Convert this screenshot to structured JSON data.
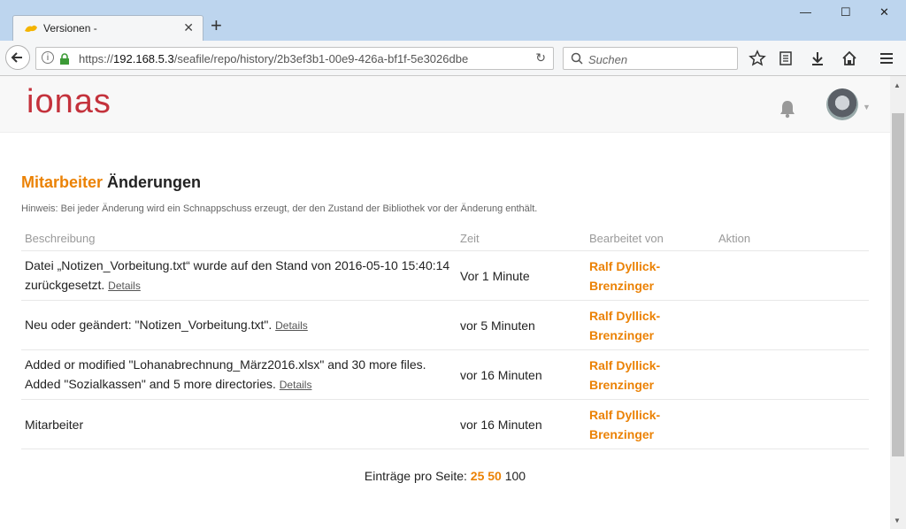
{
  "browser": {
    "tab_title": "Versionen -",
    "url_prefix": "https://",
    "url_host": "192.168.5.3",
    "url_path": "/seafile/repo/history/2b3ef3b1-00e9-426a-bf1f-5e3026dbe",
    "search_placeholder": "Suchen"
  },
  "header": {
    "logo_text": "ionas"
  },
  "page": {
    "repo_name": "Mitarbeiter",
    "title_suffix": "Änderungen",
    "hint": "Hinweis: Bei jeder Änderung wird ein Schnappschuss erzeugt, der den Zustand der Bibliothek vor der Änderung enthält."
  },
  "table": {
    "columns": [
      "Beschreibung",
      "Zeit",
      "Bearbeitet von",
      "Aktion"
    ],
    "rows": [
      {
        "desc": "Datei „Notizen_Vorbeitung.txt“ wurde auf den Stand von 2016-05-10 15:40:14 zurückgesetzt.",
        "details": "Details",
        "time": "Vor 1 Minute",
        "editor": "Ralf Dyllick-Brenzinger"
      },
      {
        "desc": "Neu oder geändert: \"Notizen_Vorbeitung.txt\".",
        "details": "Details",
        "time": "vor 5 Minuten",
        "editor": "Ralf Dyllick-Brenzinger"
      },
      {
        "desc": "Added or modified \"Lohanabrechnung_März2016.xlsx\" and 30 more files. Added \"Sozialkassen\" and 5 more directories.",
        "details": "Details",
        "time": "vor 16 Minuten",
        "editor": "Ralf Dyllick-Brenzinger"
      },
      {
        "desc": "Mitarbeiter",
        "details": "",
        "time": "vor 16 Minuten",
        "editor": "Ralf Dyllick-Brenzinger"
      }
    ]
  },
  "pager": {
    "label": "Einträge pro Seite:",
    "options": [
      "25",
      "50",
      "100"
    ]
  },
  "colors": {
    "accent": "#eb8205",
    "logo": "#c4323c"
  }
}
